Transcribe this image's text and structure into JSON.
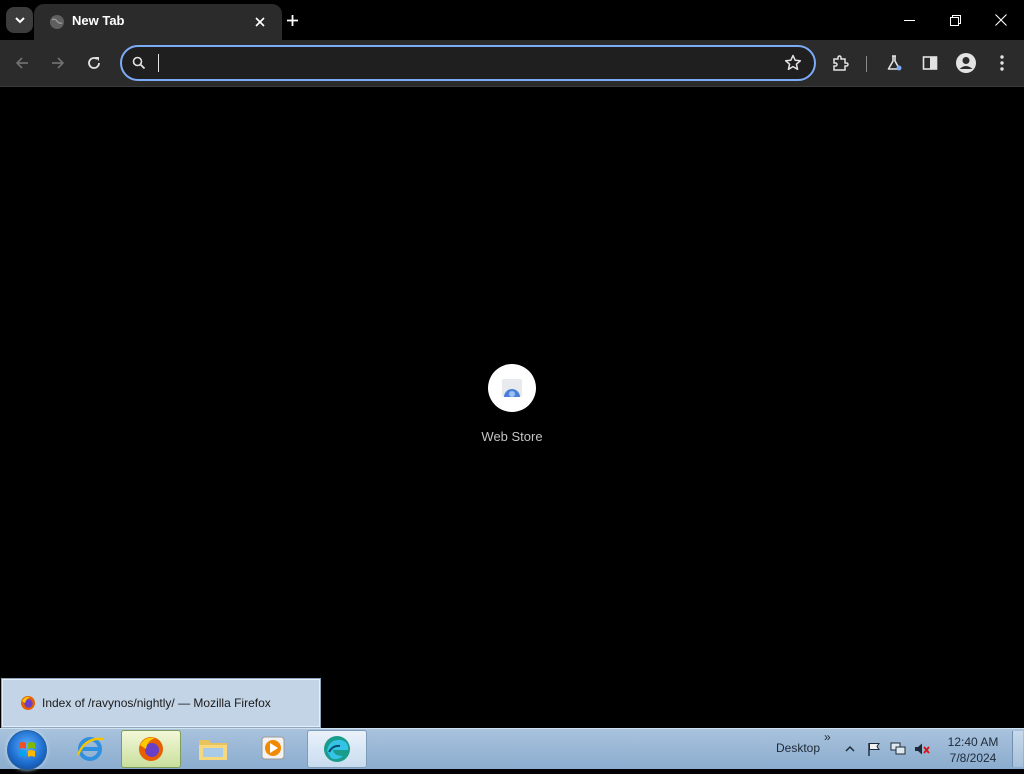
{
  "browser": {
    "tab": {
      "title": "New Tab"
    },
    "omnibox": {
      "value": "",
      "placeholder": ""
    }
  },
  "new_tab_page": {
    "shortcuts": [
      {
        "label": "Web Store",
        "icon": "web-store-icon"
      }
    ]
  },
  "taskbar": {
    "thumbnail_title": "Index of /ravynos/nightly/ — Mozilla Firefox",
    "desktop_label": "Desktop",
    "chevron": "»",
    "clock": {
      "time": "12:40 AM",
      "date": "7/8/2024"
    },
    "pinned": [
      "internet-explorer-icon",
      "firefox-icon",
      "file-explorer-icon",
      "media-player-icon",
      "edge-icon"
    ]
  },
  "colors": {
    "accent": "#7cacf8",
    "toolbar": "#2b2b2b",
    "background": "#000000",
    "taskbar": "#9bb8d6"
  }
}
